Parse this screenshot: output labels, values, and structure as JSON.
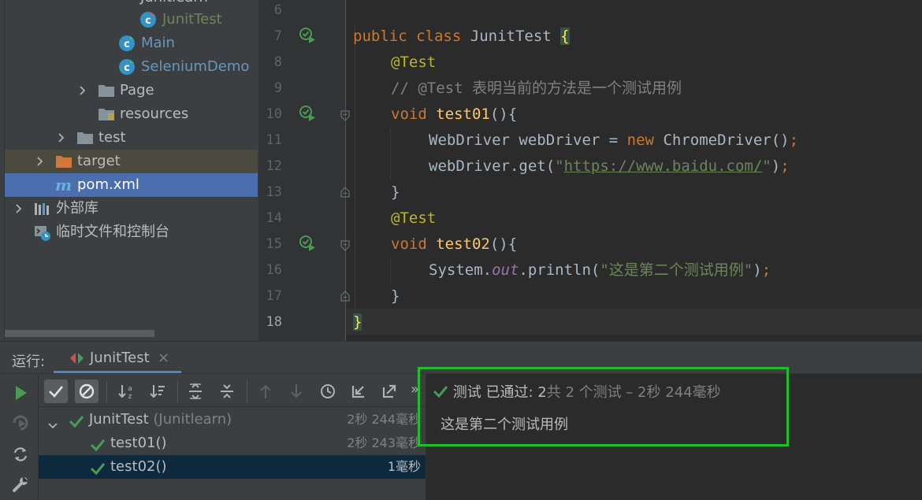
{
  "project_tree": {
    "items": [
      {
        "label": "Junitlearn",
        "kind": "package",
        "level": 0
      },
      {
        "label": "JunitTest",
        "kind": "class-test"
      },
      {
        "label": "Main",
        "kind": "class"
      },
      {
        "label": "SeleniumDemo",
        "kind": "class"
      },
      {
        "label": "Page",
        "kind": "folder"
      },
      {
        "label": "resources",
        "kind": "resources-folder"
      },
      {
        "label": "test",
        "kind": "folder"
      },
      {
        "label": "target",
        "kind": "excluded-folder"
      },
      {
        "label": "pom.xml",
        "kind": "maven-file"
      },
      {
        "label": "外部库",
        "kind": "libraries"
      },
      {
        "label": "临时文件和控制台",
        "kind": "scratches"
      }
    ]
  },
  "editor": {
    "line_numbers": [
      "6",
      "7",
      "8",
      "9",
      "10",
      "11",
      "12",
      "13",
      "14",
      "15",
      "16",
      "17",
      "18"
    ],
    "current_line": "18",
    "lines": {
      "l7": {
        "kw1": "public",
        "kw2": "class",
        "name": "JunitTest",
        "brace": "{"
      },
      "l8": {
        "ann": "@Test"
      },
      "l9": {
        "comment": "// @Test 表明当前的方法是一个测试用例"
      },
      "l10": {
        "kw": "void",
        "fn": "test01",
        "rest": "(){"
      },
      "l11": {
        "t1": "WebDriver webDriver = ",
        "kw": "new",
        "t2": " ChromeDriver()",
        "semi": ";"
      },
      "l12": {
        "t1": "webDriver.get(",
        "q1": "\"",
        "url": "https://www.baidu.com/",
        "q2": "\"",
        "t2": ")",
        "semi": ";"
      },
      "l13": {
        "t": "}"
      },
      "l14": {
        "ann": "@Test"
      },
      "l15": {
        "kw": "void",
        "fn": "test02",
        "rest": "(){"
      },
      "l16": {
        "t1": "System.",
        "stat": "out",
        "t2": ".println(",
        "str": "\"这是第二个测试用例\"",
        "t3": ")",
        "semi": ";"
      },
      "l17": {
        "t": "}"
      },
      "l18": {
        "t": "}"
      }
    }
  },
  "run_panel": {
    "label": "运行:",
    "tab_label": "JunitTest",
    "tab_close": "×",
    "toolbar_more": "»",
    "tests": [
      {
        "name": "JunitTest",
        "sub": " (Junitlearn)",
        "time": "2秒 244毫秒",
        "status": "passed"
      },
      {
        "name": "test01()",
        "sub": "",
        "time": "2秒 243毫秒",
        "status": "passed"
      },
      {
        "name": "test02()",
        "sub": "",
        "time": "1毫秒",
        "status": "passed"
      }
    ],
    "result": {
      "status": "测试 已通过:",
      "count": " 2",
      "summary": "共 2 个测试 – 2秒 244毫秒"
    },
    "console_output": "这是第二个测试用例"
  },
  "colors": {
    "pass_green": "#499c54",
    "highlight_box": "#1fbf2b",
    "selection_blue": "#4b6eaf",
    "keyword": "#cc7832",
    "annotation": "#bbb529"
  }
}
